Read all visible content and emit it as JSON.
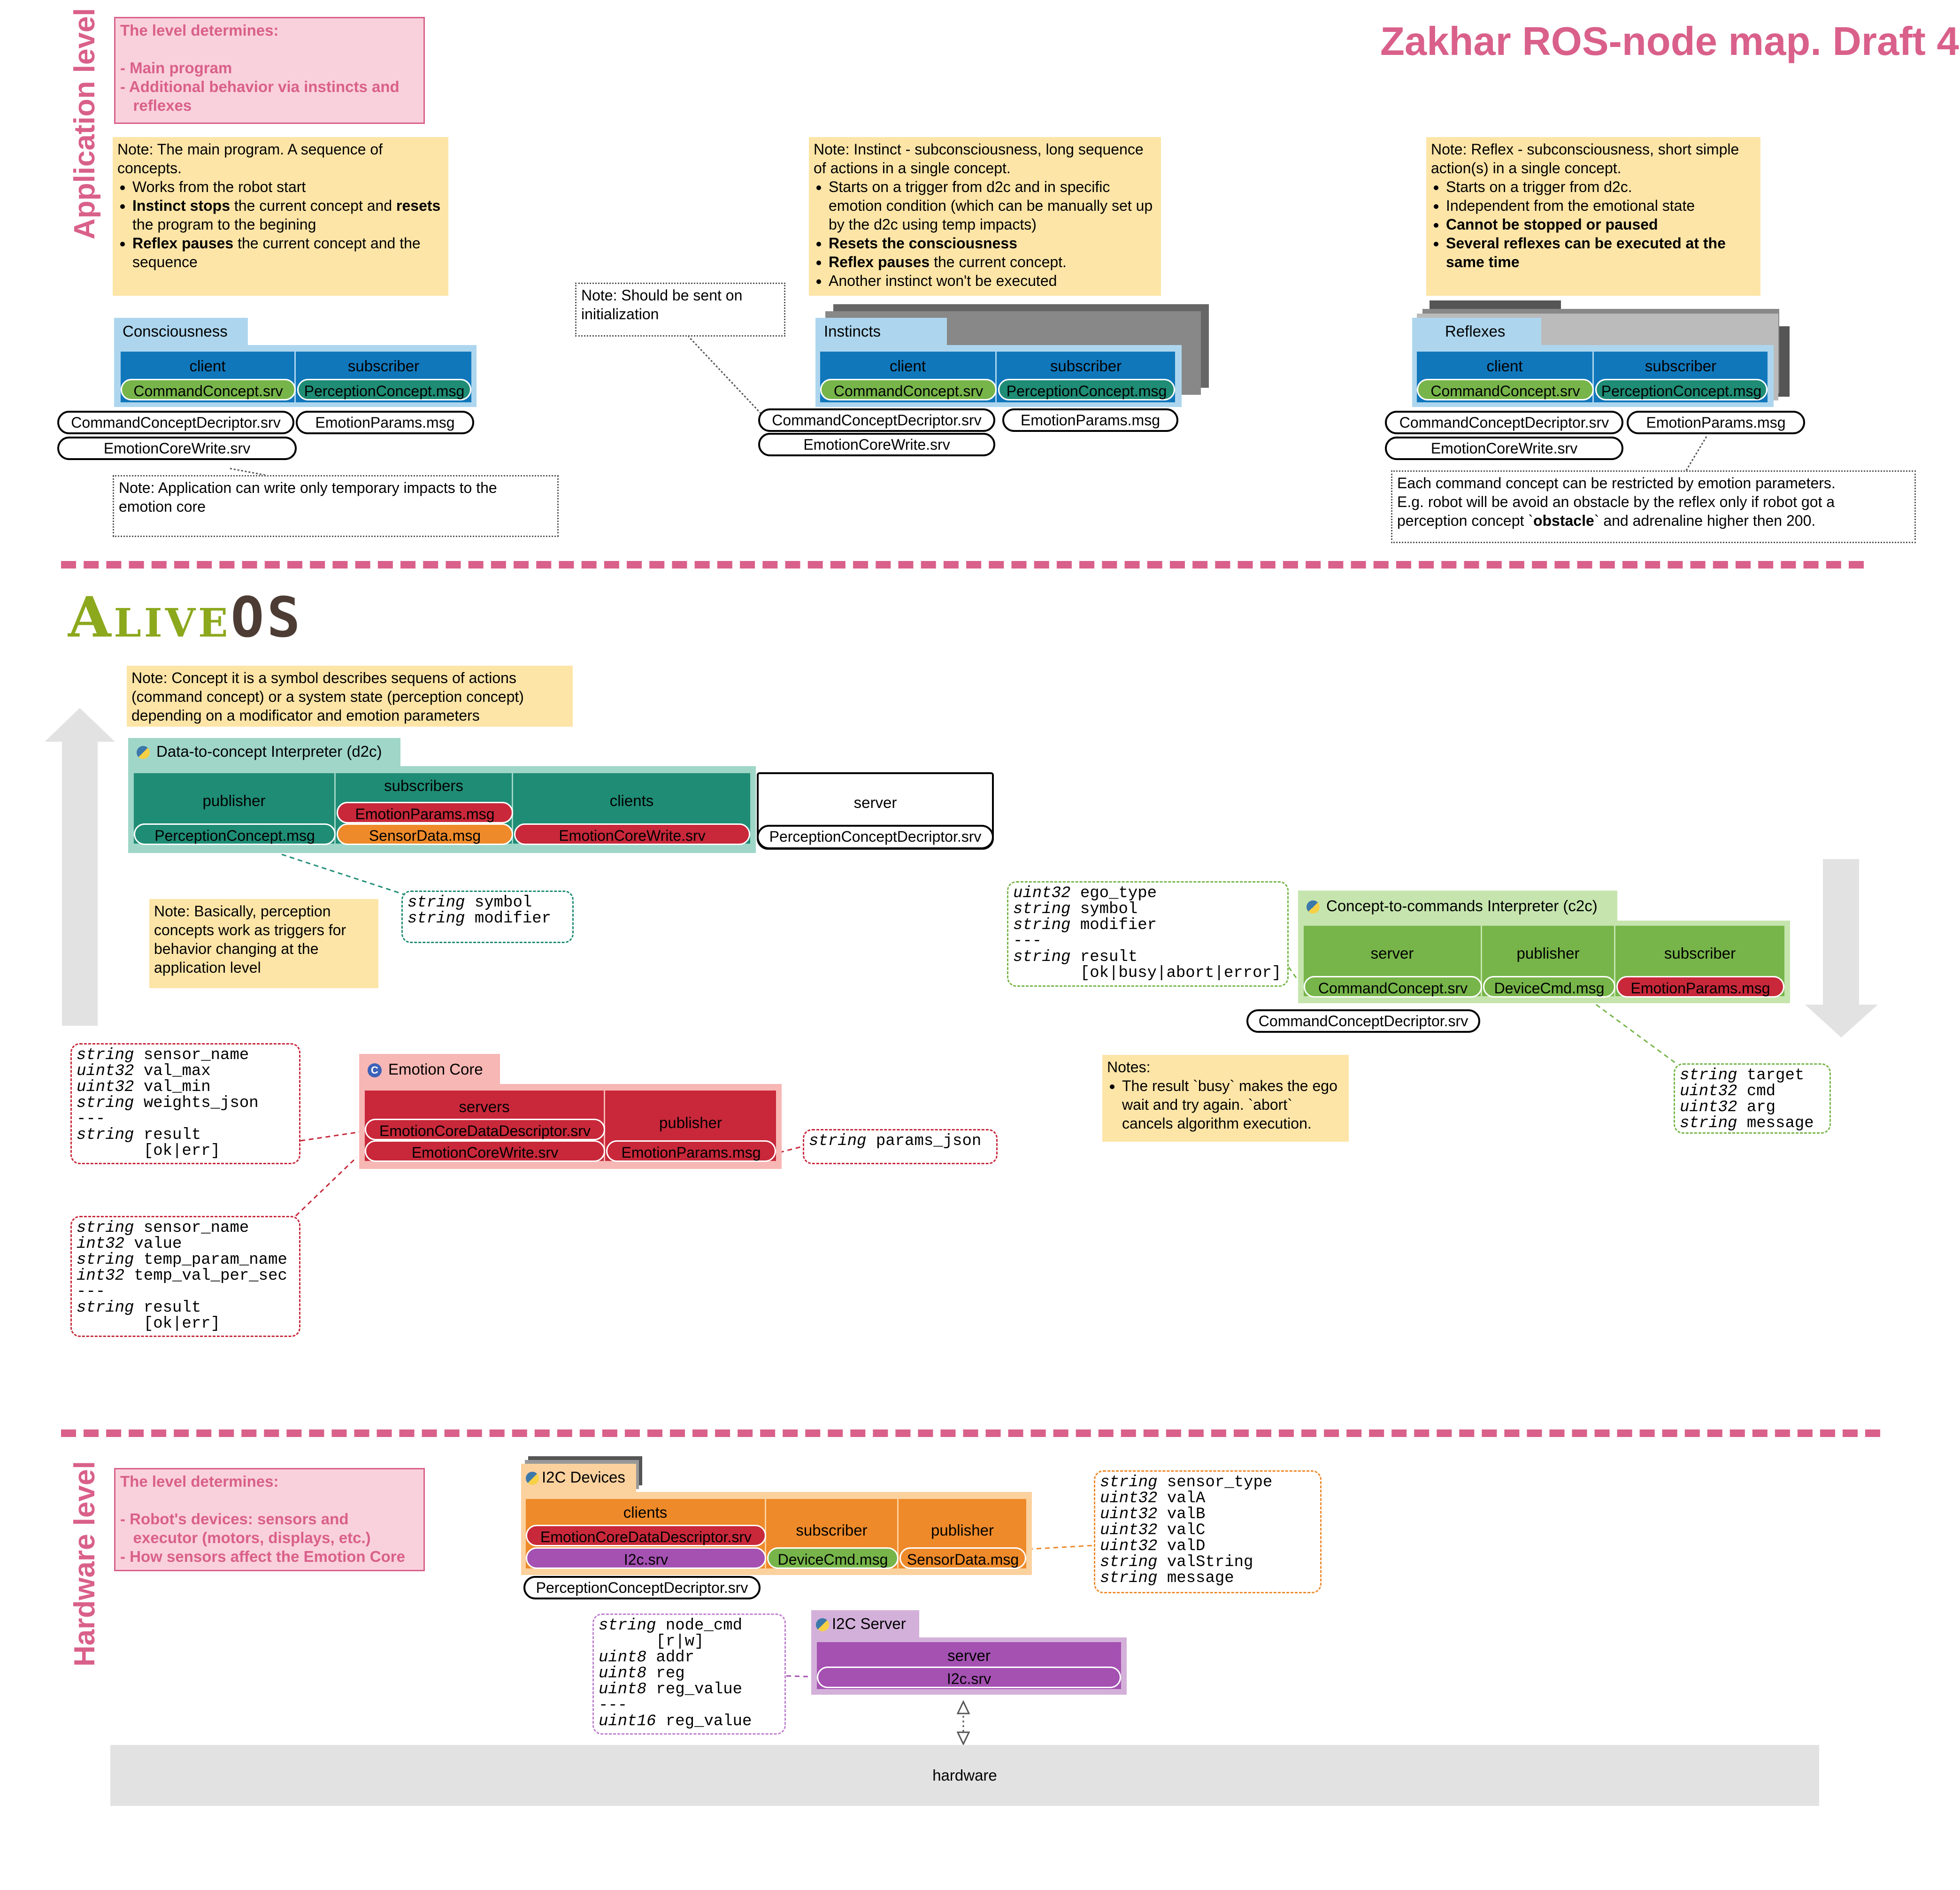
{
  "title": "Zakhar ROS-node map. Draft 4",
  "levels": {
    "application": "Application level",
    "hardware": "Hardware level"
  },
  "logo": {
    "part1": "Alive",
    "part2": "OS"
  },
  "app_level_box": {
    "line1": "The level determines:",
    "line2": "",
    "line3": "- Main program",
    "line4": "- Additional behavior via instincts and",
    "line5": "   reflexes"
  },
  "hw_level_box": {
    "line1": "The level determines:",
    "line2": "",
    "line3": "- Robot's devices: sensors and",
    "line4": "   executor (motors, displays, etc.)",
    "line5": "- How sensors affect the Emotion Core"
  },
  "notes": {
    "main_program": {
      "intro": "Note: The main program. A sequence of concepts.",
      "b1": "Works from the robot start",
      "b2a": "Instinct stops",
      "b2b": " the current concept and ",
      "b2c": "resets",
      "b2d": " the program to the begining",
      "b3a": "Reflex pauses",
      "b3b": " the current concept and the sequence"
    },
    "instinct": {
      "intro": "Note: Instinct - subconsciousness, long sequence of actions in a single concept.",
      "b1": "Starts on a trigger from d2c and in specific emotion condition (which can be manually set up by the d2c using temp impacts)",
      "b2": "Resets the consciousness",
      "b3a": "Reflex pauses",
      "b3b": " the current concept.",
      "b4": "Another instinct won't be executed"
    },
    "reflex": {
      "intro": "Note: Reflex - subconsciousness, short simple action(s) in a single concept.",
      "b1": "Starts on a trigger from d2c.",
      "b2": "Independent from the emotional state",
      "b3": "Cannot be stopped or paused",
      "b4": "Several reflexes can be executed at the same time"
    },
    "init": "Note: Should be sent on initialization",
    "temp_impacts": "Note: Application can write only temporary impacts to the emotion core",
    "restrict": {
      "l1": "Each command concept can be restricted by emotion parameters.",
      "l2": "E.g. robot will be avoid an obstacle by the reflex only if robot got a",
      "l3a": "perception concept `",
      "l3b": "obstacle",
      "l3c": "` and adrenaline higher then 200."
    },
    "concept": "Note: Concept it is a symbol  describes sequens of actions (command concept) or a system state (perception concept) depending on a modificator and emotion parameters",
    "perception": "Note: Basically, perception concepts work as triggers for behavior changing at the application level",
    "c2c": {
      "l1": "Notes:",
      "b1": "The result `busy` makes the ego wait and try again. `abort` cancels algorithm execution."
    }
  },
  "consciousness": {
    "name": "Consciousness",
    "client": "client",
    "subscriber": "subscriber",
    "client_srv": "CommandConcept.srv",
    "sub_msg": "PerceptionConcept.msg",
    "p1": "CommandConceptDecriptor.srv",
    "p2": "EmotionParams.msg",
    "p3": "EmotionCoreWrite.srv"
  },
  "instincts": {
    "name": "Instincts",
    "client": "client",
    "subscriber": "subscriber",
    "client_srv": "CommandConcept.srv",
    "sub_msg": "PerceptionConcept.msg",
    "p1": "CommandConceptDecriptor.srv",
    "p2": "EmotionParams.msg",
    "p3": "EmotionCoreWrite.srv"
  },
  "reflexes": {
    "name": "Reflexes",
    "client": "client",
    "subscriber": "subscriber",
    "client_srv": "CommandConcept.srv",
    "sub_msg": "PerceptionConcept.msg",
    "p1": "CommandConceptDecriptor.srv",
    "p2": "EmotionParams.msg",
    "p3": "EmotionCoreWrite.srv"
  },
  "d2c": {
    "name": "Data-to-concept Interpreter (d2c)",
    "publisher": "publisher",
    "subscribers": "subscribers",
    "clients": "clients",
    "server": "server",
    "pub_msg": "PerceptionConcept.msg",
    "sub1": "EmotionParams.msg",
    "sub2": "SensorData.msg",
    "client_srv": "EmotionCoreWrite.srv",
    "server_srv": "PerceptionConceptDecriptor.srv"
  },
  "c2c": {
    "name": "Concept-to-commands Interpreter (c2c)",
    "server": "server",
    "publisher": "publisher",
    "subscriber": "subscriber",
    "server_srv": "CommandConcept.srv",
    "pub_msg": "DeviceCmd.msg",
    "sub_msg": "EmotionParams.msg",
    "p1": "CommandConceptDecriptor.srv"
  },
  "emotion_core": {
    "name": "Emotion Core",
    "servers": "servers",
    "publisher": "publisher",
    "s1": "EmotionCoreDataDescriptor.srv",
    "s2": "EmotionCoreWrite.srv",
    "pub_msg": "EmotionParams.msg"
  },
  "i2c_devices": {
    "name": "I2C Devices",
    "clients": "clients",
    "subscriber": "subscriber",
    "publisher": "publisher",
    "c1": "EmotionCoreDataDescriptor.srv",
    "c2": "I2c.srv",
    "sub_msg": "DeviceCmd.msg",
    "pub_msg": "SensorData.msg",
    "p1": "PerceptionConceptDecriptor.srv"
  },
  "i2c_server": {
    "name": "I2C Server",
    "server": "server",
    "srv": "I2c.srv"
  },
  "hardware": "hardware",
  "code": {
    "symbol": [
      [
        "string",
        " symbol"
      ],
      [
        "string",
        " modifier"
      ]
    ],
    "c2c_cmd": [
      [
        "uint32",
        " ego_type"
      ],
      [
        "string",
        " symbol"
      ],
      [
        "string",
        " modifier"
      ],
      [
        "",
        "---"
      ],
      [
        "string",
        " result"
      ],
      [
        "",
        "       [ok|busy|abort|error]"
      ]
    ],
    "descriptor": [
      [
        "string",
        " sensor_name"
      ],
      [
        "uint32",
        " val_max"
      ],
      [
        "uint32",
        " val_min"
      ],
      [
        "string",
        " weights_json"
      ],
      [
        "",
        "---"
      ],
      [
        "string",
        " result"
      ],
      [
        "",
        "       [ok|err]"
      ]
    ],
    "write": [
      [
        "string",
        " sensor_name"
      ],
      [
        "int32",
        " value"
      ],
      [
        "string",
        " temp_param_name"
      ],
      [
        "int32",
        " temp_val_per_sec"
      ],
      [
        "",
        "---"
      ],
      [
        "string",
        " result"
      ],
      [
        "",
        "       [ok|err]"
      ]
    ],
    "params": [
      [
        "string",
        " params_json"
      ]
    ],
    "devcmd": [
      [
        "string",
        " target"
      ],
      [
        "uint32",
        " cmd"
      ],
      [
        "uint32",
        " arg"
      ],
      [
        "string",
        " message"
      ]
    ],
    "sensor": [
      [
        "string",
        " sensor_type"
      ],
      [
        "uint32",
        " valA"
      ],
      [
        "uint32",
        " valB"
      ],
      [
        "uint32",
        " valC"
      ],
      [
        "uint32",
        " valD"
      ],
      [
        "string",
        " valString"
      ],
      [
        "string",
        " message"
      ]
    ],
    "i2c": [
      [
        "string",
        " node_cmd"
      ],
      [
        "",
        "      [r|w]"
      ],
      [
        "uint8",
        " addr"
      ],
      [
        "uint8",
        " reg"
      ],
      [
        "uint8",
        " reg_value"
      ],
      [
        "",
        "---"
      ],
      [
        "uint16",
        " reg_value"
      ]
    ]
  },
  "colors": {
    "pink": "#d9608a",
    "blue_dark": "#1177bb",
    "blue_light": "#add6ee",
    "teal": "#1f8c75",
    "teal_light": "#9fd6c8",
    "green": "#77b54a",
    "red": "#c8283a",
    "orange": "#ee8a2a",
    "purple": "#a451b2",
    "note_yellow": "#fde5a7"
  }
}
